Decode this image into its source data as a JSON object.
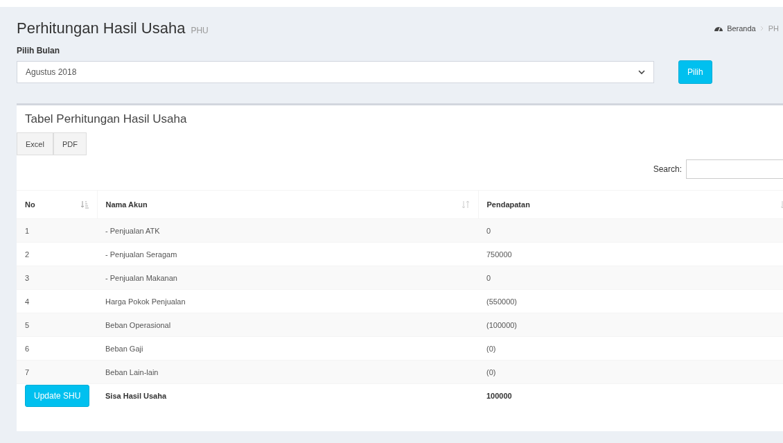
{
  "header": {
    "title": "Perhitungan Hasil Usaha",
    "subtitle": "PHU",
    "breadcrumb": [
      {
        "label": "Beranda",
        "kind": "home"
      },
      {
        "label": "PH",
        "kind": "page"
      }
    ]
  },
  "filter": {
    "label": "Pilih Bulan",
    "value": "Agustus 2018",
    "button": "Pilih"
  },
  "card": {
    "title": "Tabel Perhitungan Hasil Usaha",
    "export_buttons": [
      "Excel",
      "PDF"
    ],
    "search_label": "Search:",
    "table": {
      "columns": [
        {
          "label": "No",
          "sorted": true
        },
        {
          "label": "Nama Akun",
          "sorted": false
        },
        {
          "label": "Pendapatan",
          "sorted": false
        }
      ],
      "rows": [
        {
          "no": "1",
          "name": "- Penjualan ATK",
          "value": "0"
        },
        {
          "no": "2",
          "name": "- Penjualan Seragam",
          "value": "750000"
        },
        {
          "no": "3",
          "name": "- Penjualan Makanan",
          "value": "0"
        },
        {
          "no": "4",
          "name": "Harga Pokok Penjualan",
          "value": "(550000)"
        },
        {
          "no": "5",
          "name": "Beban Operasional",
          "value": "(100000)"
        },
        {
          "no": "6",
          "name": "Beban Gaji",
          "value": "(0)"
        },
        {
          "no": "7",
          "name": "Beban Lain-lain",
          "value": "(0)"
        }
      ],
      "footer": {
        "button": "Update SHU",
        "name": "Sisa Hasil Usaha",
        "value": "100000"
      }
    }
  }
}
